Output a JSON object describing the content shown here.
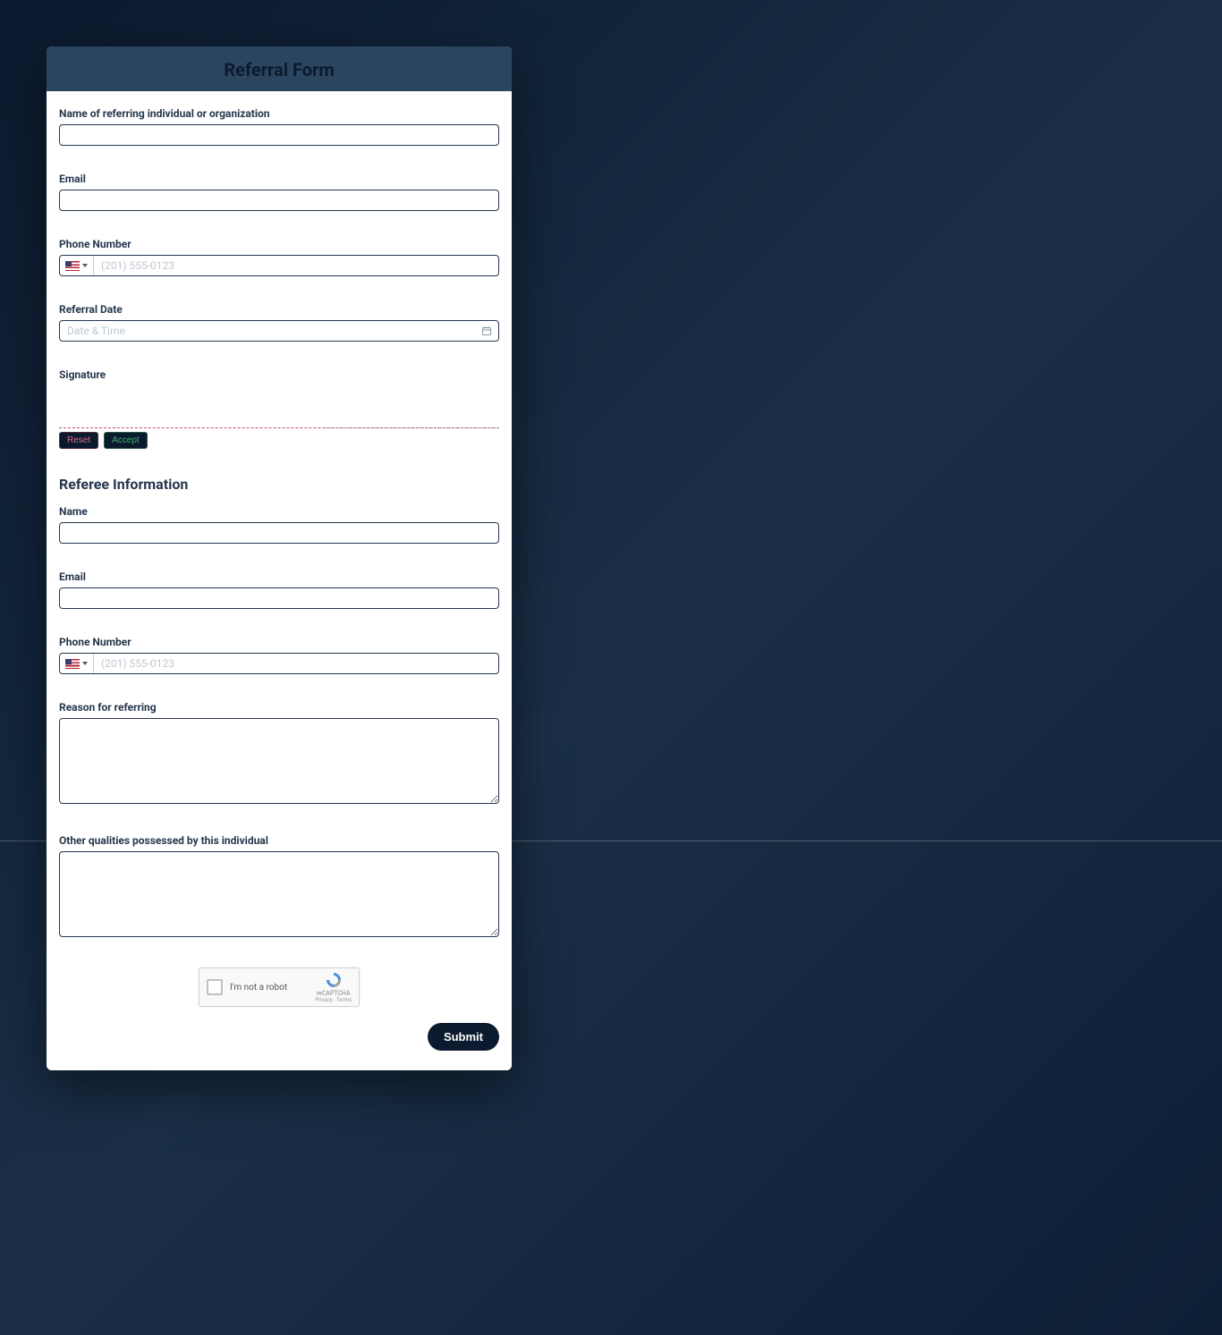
{
  "form": {
    "title": "Referral Form",
    "referrer": {
      "name_label": "Name of referring individual or organization",
      "email_label": "Email",
      "phone_label": "Phone Number",
      "phone_placeholder": "(201) 555-0123",
      "date_label": "Referral Date",
      "date_placeholder": "Date & Time",
      "signature_label": "Signature",
      "reset_label": "Reset",
      "accept_label": "Accept"
    },
    "referee": {
      "heading": "Referee Information",
      "name_label": "Name",
      "email_label": "Email",
      "phone_label": "Phone Number",
      "phone_placeholder": "(201) 555-0123",
      "reason_label": "Reason for referring",
      "qualities_label": "Other qualities possessed by this individual"
    },
    "captcha": {
      "label": "I'm not a robot",
      "brand": "reCAPTCHA",
      "terms": "Privacy - Terms"
    },
    "submit_label": "Submit"
  }
}
